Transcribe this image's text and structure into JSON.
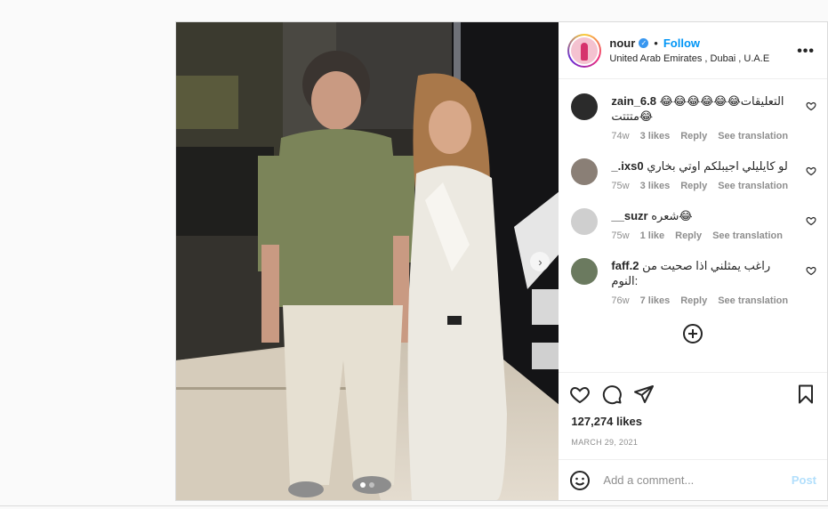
{
  "header": {
    "username": "nour",
    "separator": "•",
    "follow_label": "Follow",
    "location": "United Arab Emirates , Dubai , U.A.E",
    "more_label": "•••"
  },
  "comments": [
    {
      "user": "zain_6.8",
      "text": "التعليقات😂😂😂😂😂😂 متتتت😂",
      "time": "74w",
      "likes": "3 likes",
      "reply": "Reply",
      "translate": "See translation",
      "avatar_color": "#2b2b2b"
    },
    {
      "user": "_.ixs0",
      "text": "لو كايليلي اجيبلكم اوتي بخاري",
      "time": "75w",
      "likes": "3 likes",
      "reply": "Reply",
      "translate": "See translation",
      "avatar_color": "#8a7f76"
    },
    {
      "user": "__suzr",
      "text": "شعره😂",
      "time": "75w",
      "likes": "1 like",
      "reply": "Reply",
      "translate": "See translation",
      "avatar_color": "#cfcfcf"
    },
    {
      "user": "faff.2",
      "text": "راغب يمثلني اذا صحيت من النوم:",
      "time": "76w",
      "likes": "7 likes",
      "reply": "Reply",
      "translate": "See translation",
      "avatar_color": "#6b7a5f"
    }
  ],
  "likes_count": "127,274 likes",
  "post_date": "MARCH 29, 2021",
  "add_comment": {
    "placeholder": "Add a comment...",
    "post_label": "Post"
  },
  "media": {
    "next_arrow": "›",
    "carousel_index": 1,
    "carousel_total": 2
  },
  "colors": {
    "accent": "#0095f6",
    "post_disabled": "#b2dffc",
    "meta_grey": "#8e8e8e"
  },
  "icons": [
    "verified-badge-icon",
    "more-options-icon",
    "heart-icon",
    "comment-icon",
    "share-icon",
    "bookmark-icon",
    "load-more-icon",
    "emoji-icon",
    "chevron-right-icon"
  ]
}
